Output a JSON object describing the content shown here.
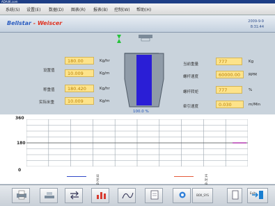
{
  "window": {
    "title": "ADA4K.com"
  },
  "menu": {
    "items": [
      "系统(S)",
      "设置(E)",
      "数据(D)",
      "图表(R)",
      "报表(B)",
      "控制(W)",
      "帮助(H)"
    ]
  },
  "header": {
    "brand_main": "Bellstar",
    "brand_accent": "- Weiscer",
    "date": "2009-9-9",
    "time": "8:31:44"
  },
  "left": {
    "rows": [
      {
        "label": "设置值",
        "value": "180.00",
        "unit": "Kg/hr"
      },
      {
        "label": "",
        "value": "10.009",
        "unit": "Kg/m"
      },
      {
        "label": "称重值",
        "value": "180.420",
        "unit": "Kg/hr"
      },
      {
        "label": "实际米重",
        "value": "10.009",
        "unit": "Kg/m"
      }
    ]
  },
  "right": {
    "rows": [
      {
        "label": "当前重量",
        "value": "777",
        "unit": "Kg"
      },
      {
        "label": "螺杆速度",
        "value": "60000.00",
        "unit": "RPM"
      },
      {
        "label": "螺杆转矩",
        "value": "777",
        "unit": "%"
      },
      {
        "label": "牵引速度",
        "value": "0.030",
        "unit": "m/Min"
      }
    ]
  },
  "hopper": {
    "percent_label": "100.0 %",
    "fill_level": 1.0
  },
  "colors": {
    "blue_series": "#2f48c8",
    "red_series": "#e55a3a",
    "fill": "#2a1ed6",
    "valve": "#25c23a"
  },
  "chart_data": {
    "type": "line",
    "yticks": [
      "360",
      "180",
      "0"
    ],
    "ylim": [
      0,
      360
    ],
    "grid": true,
    "legend": "bottom",
    "series": [
      {
        "name": "设定值",
        "values": []
      },
      {
        "name": "实时值",
        "values": [
          180,
          180
        ]
      }
    ]
  },
  "toolbar": {
    "buttons": [
      {
        "icon": "printer-icon",
        "label": ""
      },
      {
        "icon": "scale-icon",
        "label": ""
      },
      {
        "icon": "transfer-icon",
        "label": ""
      },
      {
        "icon": "chart-icon",
        "label": ""
      },
      {
        "icon": "curve-icon",
        "label": ""
      },
      {
        "icon": "document-icon",
        "label": ""
      },
      {
        "icon": "gear-icon",
        "label": ""
      },
      {
        "icon": "box-icon",
        "label": "BOX_SYS"
      },
      {
        "icon": "page-icon",
        "label": ""
      },
      {
        "icon": "exit-icon",
        "label": "Exit"
      }
    ]
  }
}
